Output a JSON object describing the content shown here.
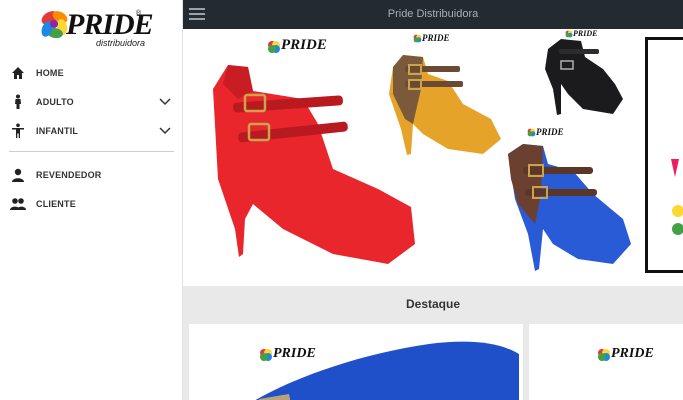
{
  "app": {
    "title": "Pride Distribuidora"
  },
  "logo": {
    "word": "PRIDE",
    "sub": "distribuidora",
    "reg": "®"
  },
  "sidebar": {
    "items": [
      {
        "label": "HOME",
        "icon": "home-icon",
        "expandable": false
      },
      {
        "label": "ADULTO",
        "icon": "adult-person-icon",
        "expandable": true
      },
      {
        "label": "INFANTIL",
        "icon": "child-person-icon",
        "expandable": true
      },
      {
        "label": "REVENDEDOR",
        "icon": "user-icon",
        "expandable": false
      },
      {
        "label": "CLIENTE",
        "icon": "users-icon",
        "expandable": false
      }
    ]
  },
  "banner": {
    "logo_text": "PRIDE",
    "logo_sub": "distribuidora",
    "shoes": [
      {
        "color": "red",
        "hex": "#e8262c"
      },
      {
        "color": "mustard",
        "hex": "#e6a32a"
      },
      {
        "color": "black",
        "hex": "#1b1b1e"
      },
      {
        "color": "blue",
        "hex": "#2a5bd6"
      }
    ]
  },
  "featured": {
    "heading": "Destaque",
    "cards": [
      {
        "logo_text": "PRIDE",
        "logo_sub": "distribuidora",
        "shoe_hex": "#1f4fc9"
      },
      {
        "logo_text": "PRIDE",
        "logo_sub": "distribuidora",
        "shoe_hex": "#d9c7a8"
      }
    ]
  },
  "colors": {
    "topbar": "#232a30",
    "accent_rainbow": [
      "#e53935",
      "#fb8c00",
      "#fdd835",
      "#43a047",
      "#1e88e5",
      "#8e24aa"
    ]
  }
}
